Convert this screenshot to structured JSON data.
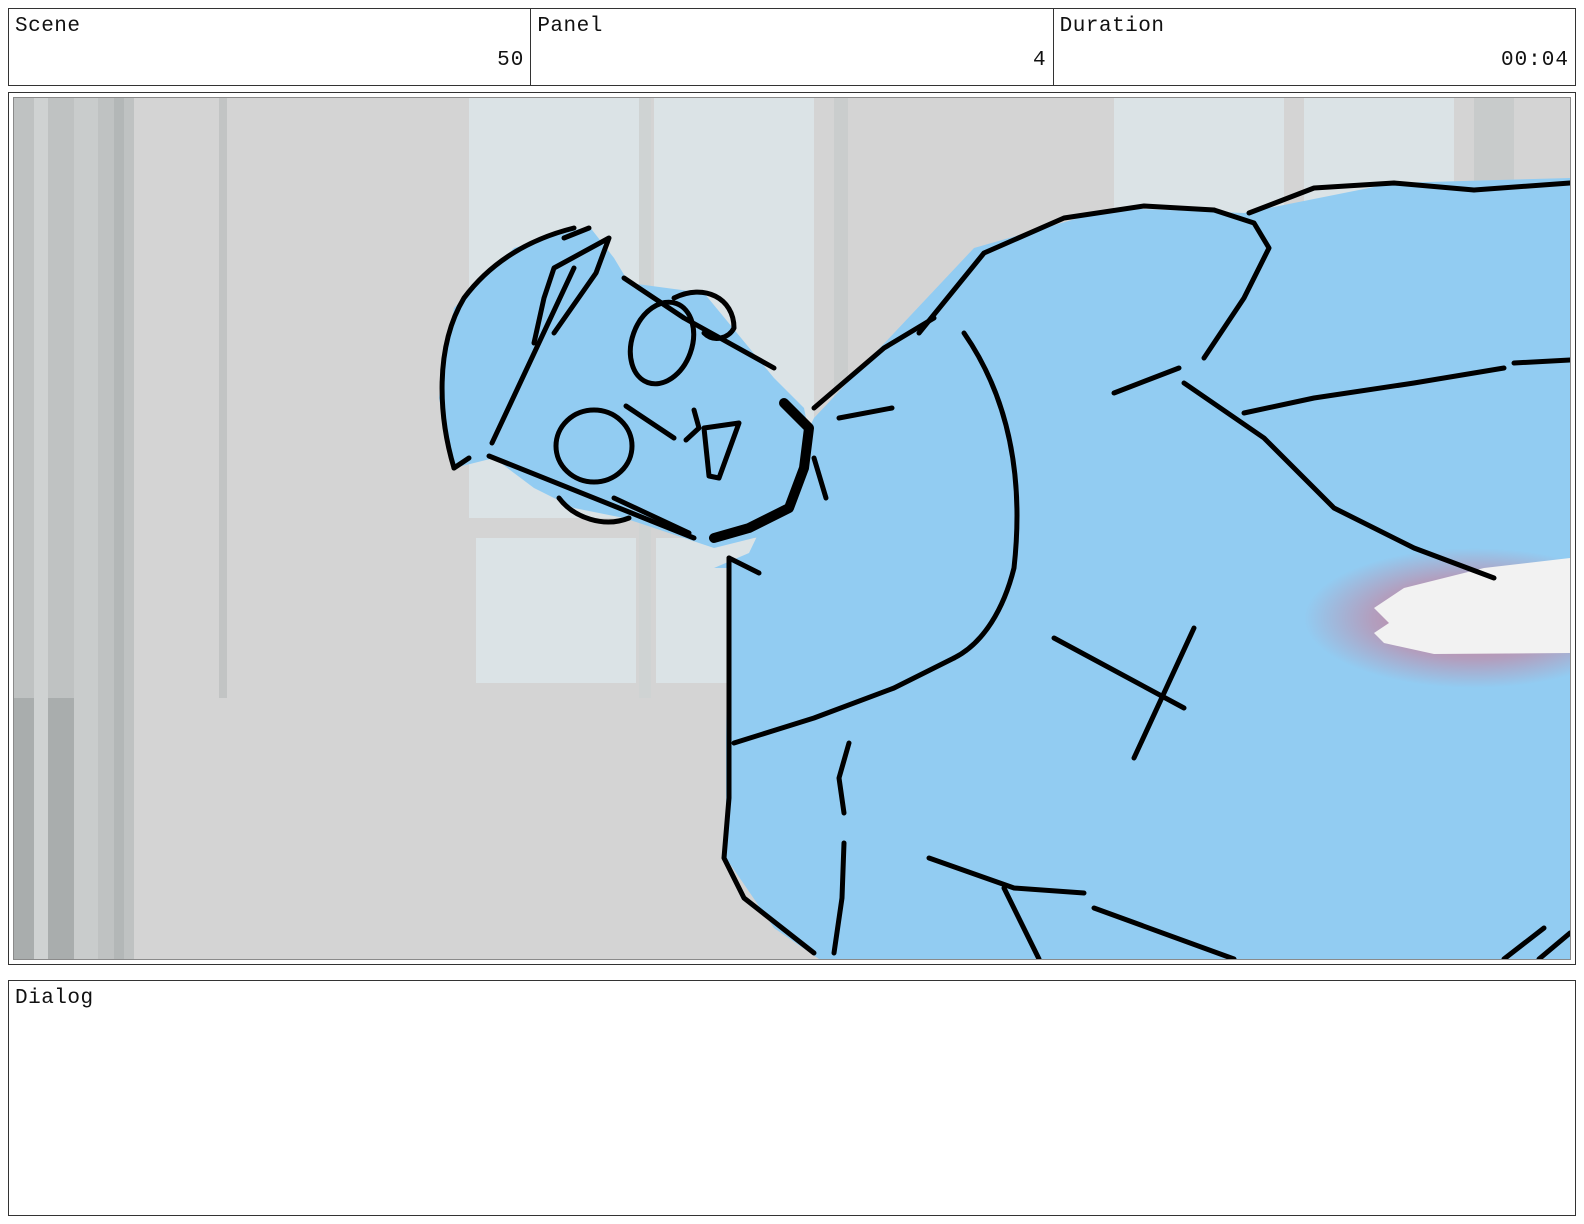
{
  "header": {
    "scene": {
      "label": "Scene",
      "value": "50"
    },
    "panel": {
      "label": "Panel",
      "value": "4"
    },
    "duration": {
      "label": "Duration",
      "value": "00:04"
    }
  },
  "artwork": {
    "colors": {
      "background": "#d4d4d4",
      "window": "#dde5e8",
      "character_fill": "#92ccf2",
      "line": "#000000",
      "glow": "#d9677f",
      "hand": "#f2f2f2"
    },
    "icon": "storyboard-sketch"
  },
  "dialog": {
    "label": "Dialog",
    "text": ""
  }
}
